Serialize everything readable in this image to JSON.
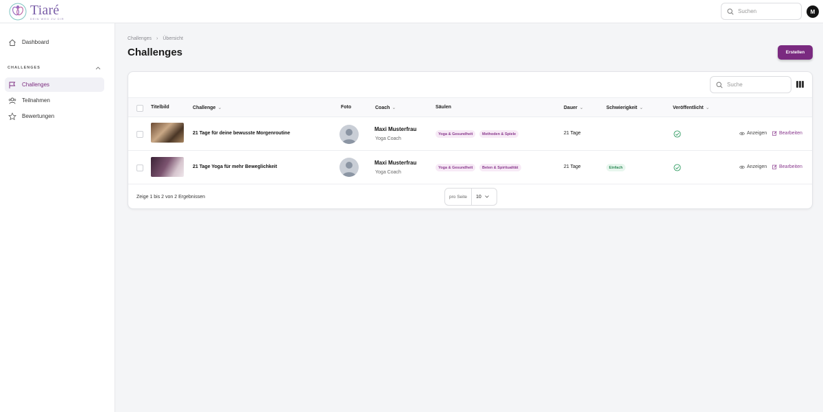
{
  "app": {
    "logo_text": "Tiaré",
    "logo_tagline": "Dein Weg zu dir"
  },
  "header": {
    "search_placeholder": "Suchen",
    "user_initial": "M"
  },
  "sidebar": {
    "dashboard": "Dashboard",
    "section_label": "CHALLENGES",
    "items": [
      {
        "label": "Challenges",
        "icon": "flag-icon",
        "active": true
      },
      {
        "label": "Teilnahmen",
        "icon": "users-icon",
        "active": false
      },
      {
        "label": "Bewertungen",
        "icon": "star-icon",
        "active": false
      }
    ]
  },
  "breadcrumb": {
    "root": "Challenges",
    "current": "Übersicht"
  },
  "page": {
    "title": "Challenges",
    "create_label": "Erstellen"
  },
  "table": {
    "search_placeholder": "Suche",
    "columns": {
      "image": "Titelbild",
      "challenge": "Challenge",
      "photo": "Foto",
      "coach": "Coach",
      "pillars": "Säulen",
      "duration": "Dauer",
      "difficulty": "Schwierigkeit",
      "published": "Veröffentlicht"
    },
    "rows": [
      {
        "title": "21 Tage für deine bewusste Morgenroutine",
        "coach_name": "Maxi Musterfrau",
        "coach_role": "Yoga Coach",
        "pillars": [
          "Yoga & Gesundheit",
          "Methoden & Spiele"
        ],
        "duration": "21 Tage",
        "difficulty": "",
        "published": true,
        "view": "Anzeigen",
        "edit": "Bearbeiten"
      },
      {
        "title": "21 Tage Yoga für mehr Beweglichkeit",
        "coach_name": "Maxi Musterfrau",
        "coach_role": "Yoga Coach",
        "pillars": [
          "Yoga & Gesundheit",
          "Beten & Spiritualität"
        ],
        "duration": "21 Tage",
        "difficulty": "Einfach",
        "published": true,
        "view": "Anzeigen",
        "edit": "Bearbeiten"
      }
    ],
    "footer": {
      "summary": "Zeige 1 bis 2 von 2 Ergebnissen",
      "per_page_label": "pro Seite",
      "per_page_value": "10"
    }
  },
  "colors": {
    "accent": "#7a2a80",
    "tag_bg": "#f7eaf6",
    "success": "#2c8a55"
  }
}
